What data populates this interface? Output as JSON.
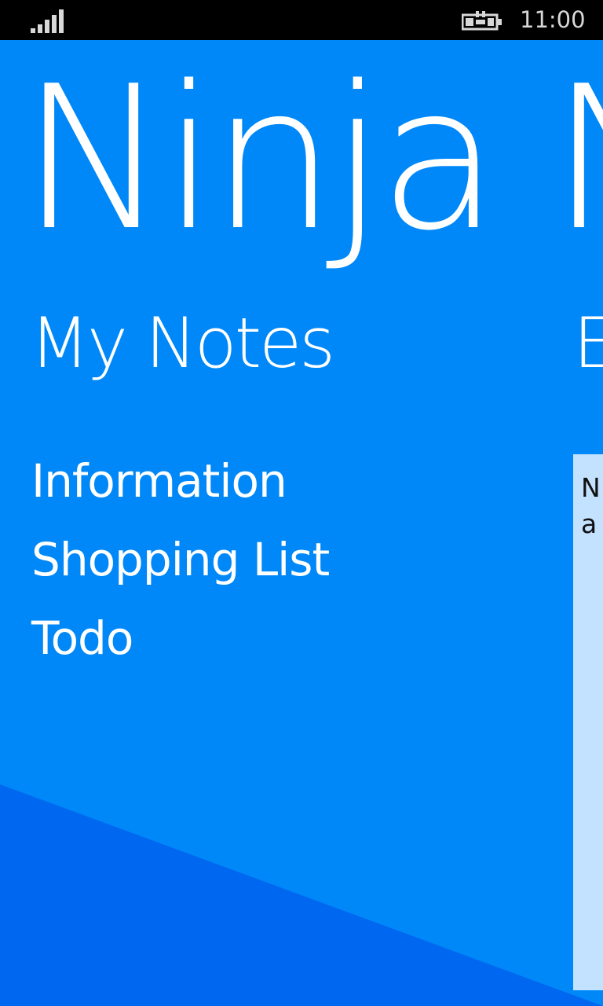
{
  "status_bar": {
    "signal_icon": "signal-strength-icon",
    "battery_icon": "battery-charging-icon",
    "time": "11:00"
  },
  "app": {
    "title": "Ninja N"
  },
  "pivot": {
    "current_header": "My Notes",
    "next_header_peek": "E"
  },
  "notes": {
    "items": [
      {
        "label": "Information"
      },
      {
        "label": "Shopping List"
      },
      {
        "label": "Todo"
      }
    ]
  },
  "editor_peek": {
    "text": "N\na"
  },
  "colors": {
    "background": "#0088f8",
    "background_shape": "#0068f0",
    "panel": "#c2e2ff",
    "status_bar": "#000000"
  }
}
